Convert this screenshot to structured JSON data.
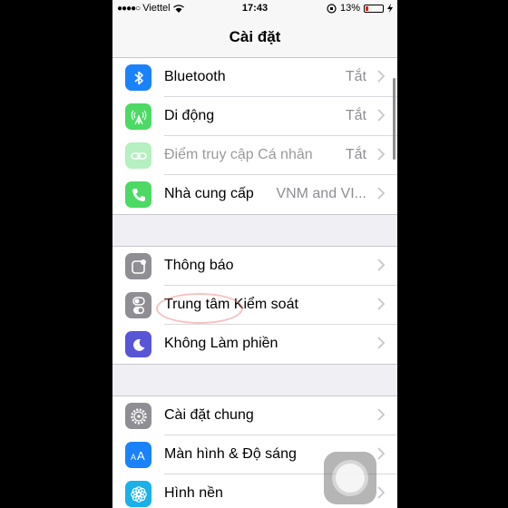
{
  "status_bar": {
    "signal_dots": "●●●●○",
    "carrier": "Viettel",
    "time": "17:43",
    "battery_percent": "13%"
  },
  "nav": {
    "title": "Cài đặt"
  },
  "groups": [
    {
      "rows": [
        {
          "label": "Bluetooth",
          "value": "Tắt",
          "icon": "bluetooth-icon",
          "color": "#1a82fb"
        },
        {
          "label": "Di động",
          "value": "Tắt",
          "icon": "cellular-icon",
          "color": "#4cd964"
        },
        {
          "label": "Điểm truy cập Cá nhân",
          "value": "Tắt",
          "icon": "hotspot-icon",
          "color": "#4cd964",
          "disabled": true
        },
        {
          "label": "Nhà cung cấp",
          "value": "VNM and VI...",
          "icon": "phone-icon",
          "color": "#4cd964"
        }
      ]
    },
    {
      "rows": [
        {
          "label": "Thông báo",
          "value": "",
          "icon": "notifications-icon",
          "color": "#8e8e93"
        },
        {
          "label": "Trung tâm Kiểm soát",
          "value": "",
          "icon": "control-center-icon",
          "color": "#8e8e93"
        },
        {
          "label": "Không Làm phiền",
          "value": "",
          "icon": "moon-icon",
          "color": "#5856d6"
        }
      ]
    },
    {
      "rows": [
        {
          "label": "Cài đặt chung",
          "value": "",
          "icon": "gear-icon",
          "color": "#8e8e93"
        },
        {
          "label": "Màn hình & Độ sáng",
          "value": "",
          "icon": "display-icon",
          "color": "#1a82fb"
        },
        {
          "label": "Hình nền",
          "value": "",
          "icon": "wallpaper-icon",
          "color": "#1ab0ea"
        }
      ]
    }
  ]
}
